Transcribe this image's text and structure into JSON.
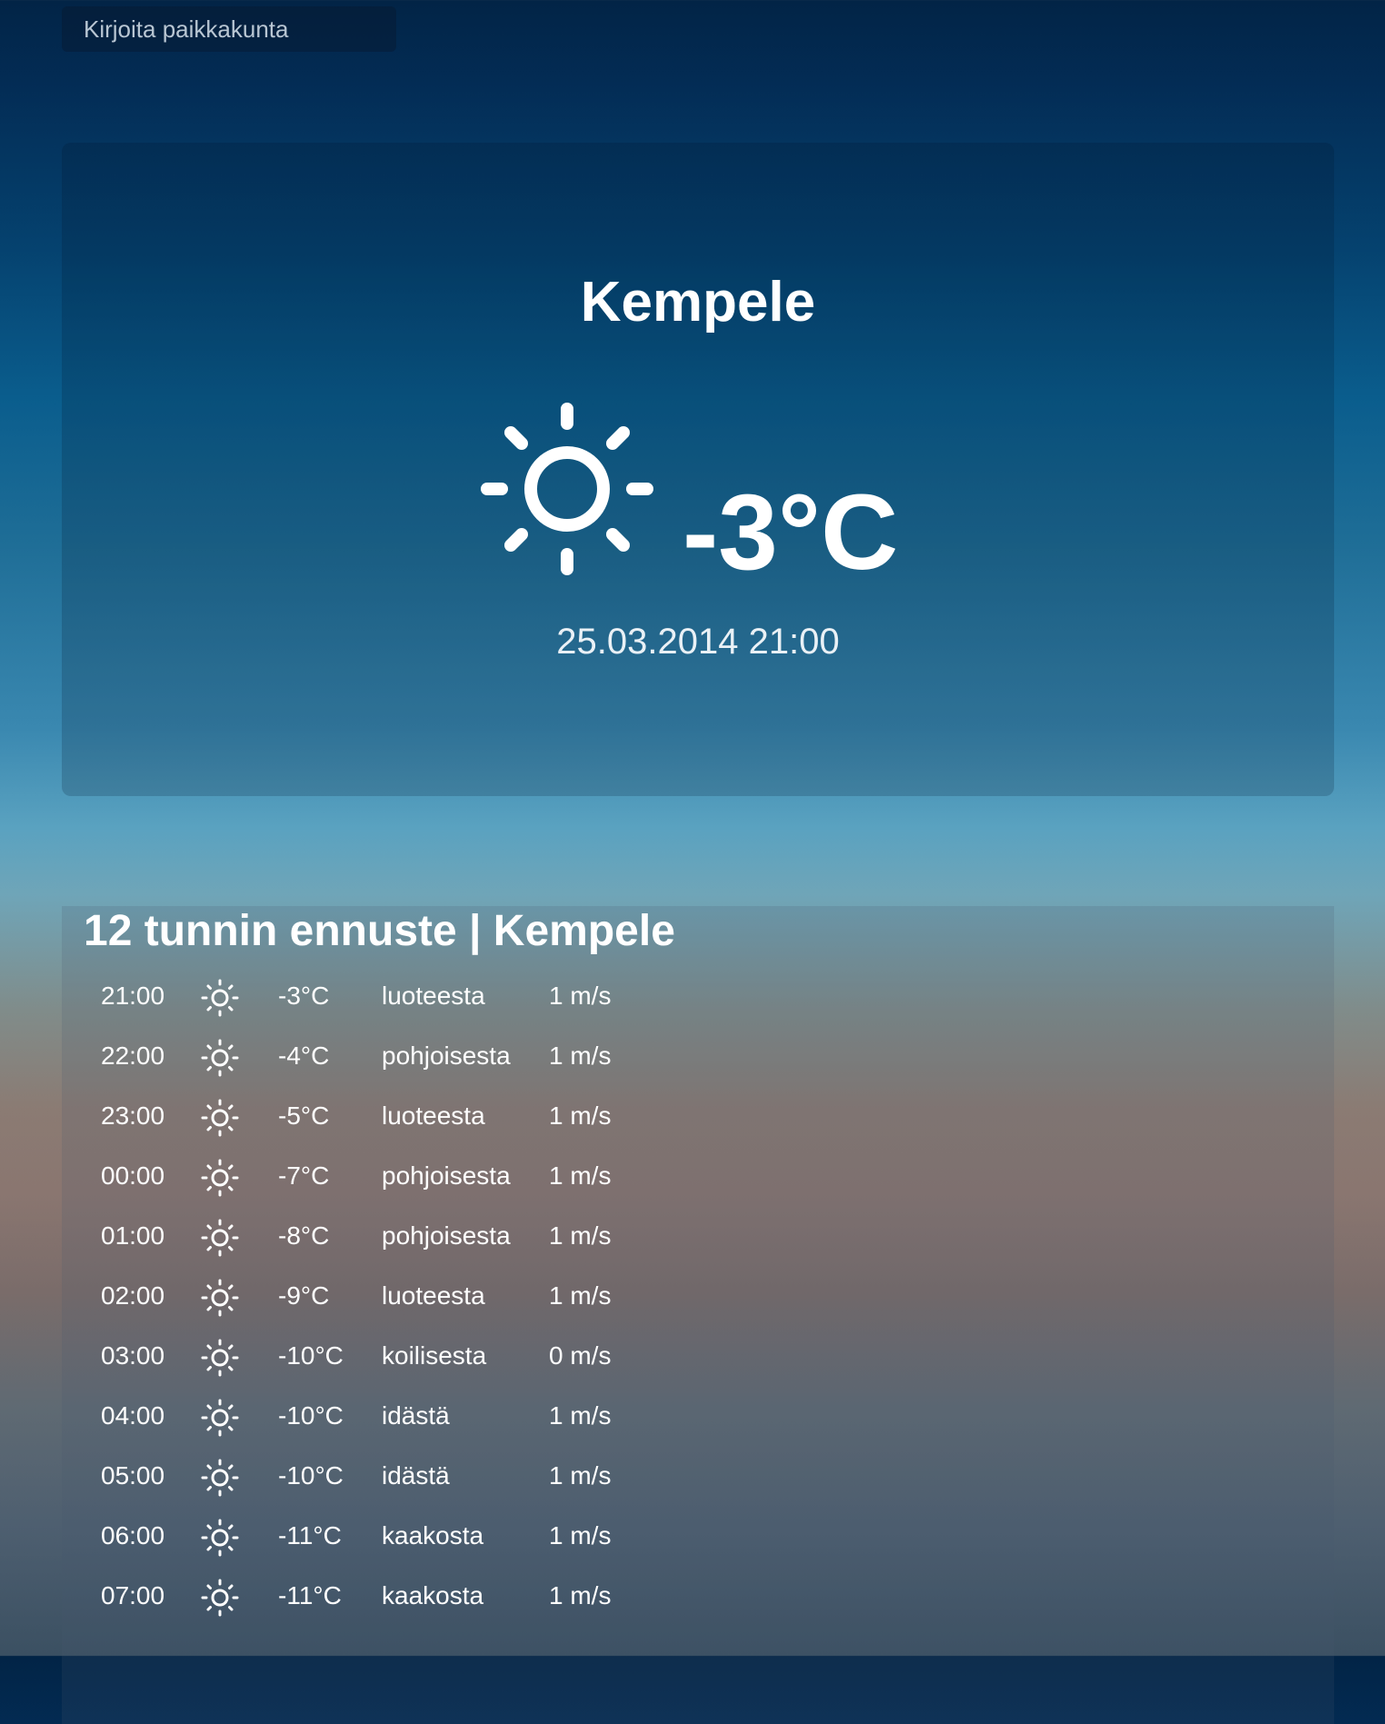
{
  "search": {
    "placeholder": "Kirjoita paikkakunta"
  },
  "current": {
    "city": "Kempele",
    "icon": "sun-icon",
    "temperature": "-3°C",
    "datetime": "25.03.2014 21:00"
  },
  "forecast": {
    "title": "12 tunnin ennuste | Kempele",
    "rows": [
      {
        "time": "21:00",
        "icon": "sun-icon",
        "temp": "-3°C",
        "direction": "luoteesta",
        "wind": "1 m/s"
      },
      {
        "time": "22:00",
        "icon": "sun-icon",
        "temp": "-4°C",
        "direction": "pohjoisesta",
        "wind": "1 m/s"
      },
      {
        "time": "23:00",
        "icon": "sun-icon",
        "temp": "-5°C",
        "direction": "luoteesta",
        "wind": "1 m/s"
      },
      {
        "time": "00:00",
        "icon": "sun-icon",
        "temp": "-7°C",
        "direction": "pohjoisesta",
        "wind": "1 m/s"
      },
      {
        "time": "01:00",
        "icon": "sun-icon",
        "temp": "-8°C",
        "direction": "pohjoisesta",
        "wind": "1 m/s"
      },
      {
        "time": "02:00",
        "icon": "sun-icon",
        "temp": "-9°C",
        "direction": "luoteesta",
        "wind": "1 m/s"
      },
      {
        "time": "03:00",
        "icon": "sun-icon",
        "temp": "-10°C",
        "direction": "koilisesta",
        "wind": "0 m/s"
      },
      {
        "time": "04:00",
        "icon": "sun-icon",
        "temp": "-10°C",
        "direction": "idästä",
        "wind": "1 m/s"
      },
      {
        "time": "05:00",
        "icon": "sun-icon",
        "temp": "-10°C",
        "direction": "idästä",
        "wind": "1 m/s"
      },
      {
        "time": "06:00",
        "icon": "sun-icon",
        "temp": "-11°C",
        "direction": "kaakosta",
        "wind": "1 m/s"
      },
      {
        "time": "07:00",
        "icon": "sun-icon",
        "temp": "-11°C",
        "direction": "kaakosta",
        "wind": "1 m/s"
      }
    ]
  },
  "colors": {
    "text": "#ffffff",
    "sky_top": "#022446",
    "sky_mid": "#5aa2c0",
    "dusk": "#8b7b73"
  }
}
